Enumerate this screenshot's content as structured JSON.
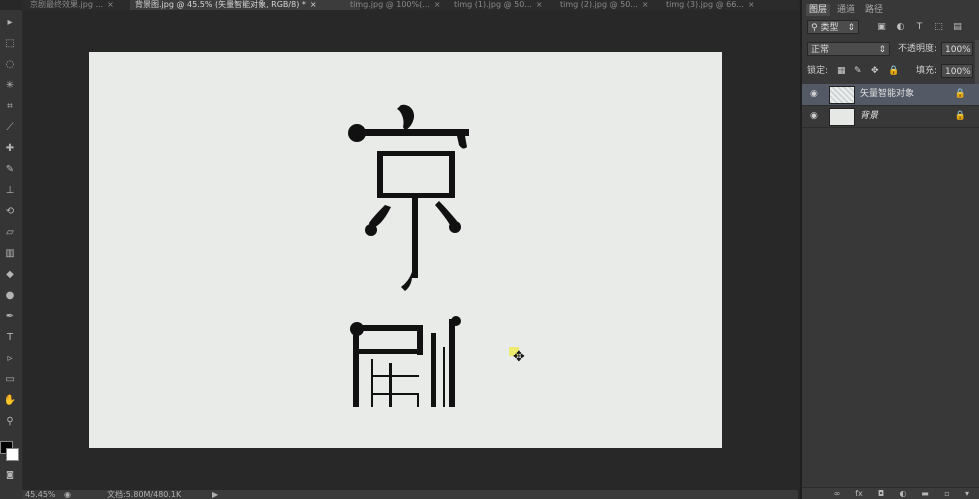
{
  "tabs": [
    {
      "label": "京剧最终效果.jpg ...",
      "close": "×",
      "active": false
    },
    {
      "label": "背景图.jpg @ 45.5% (矢量智能对象, RGB/8) *",
      "close": "×",
      "active": true
    },
    {
      "label": "timg.jpg @ 100%(...",
      "close": "×",
      "active": false
    },
    {
      "label": "timg (1).jpg @ 50...",
      "close": "×",
      "active": false
    },
    {
      "label": "timg (2).jpg @ 50...",
      "close": "×",
      "active": false
    },
    {
      "label": "timg (3).jpg @ 66...",
      "close": "×",
      "active": false
    }
  ],
  "status": {
    "zoom": "45.45%",
    "doc_info": "文档:5.80M/480.1K",
    "arrow": "▶"
  },
  "panel": {
    "tabs": [
      "图层",
      "通道",
      "路径"
    ],
    "filter_label": "类型",
    "blend_mode": "正常",
    "opacity_label": "不透明度:",
    "opacity_value": "100%",
    "lock_label": "锁定:",
    "fill_label": "填充:",
    "fill_value": "100%",
    "layers": [
      {
        "name": "矢量智能对象",
        "selected": true
      },
      {
        "name": "背景",
        "selected": false
      }
    ]
  },
  "icons": {
    "eye": "eye-icon",
    "lock": "lock-icon",
    "move": "move-cursor-icon"
  },
  "colors": {
    "canvas": "#e9ebe8",
    "workspace": "#282828",
    "selected_layer": "#535a66",
    "artwork": "#111111"
  }
}
